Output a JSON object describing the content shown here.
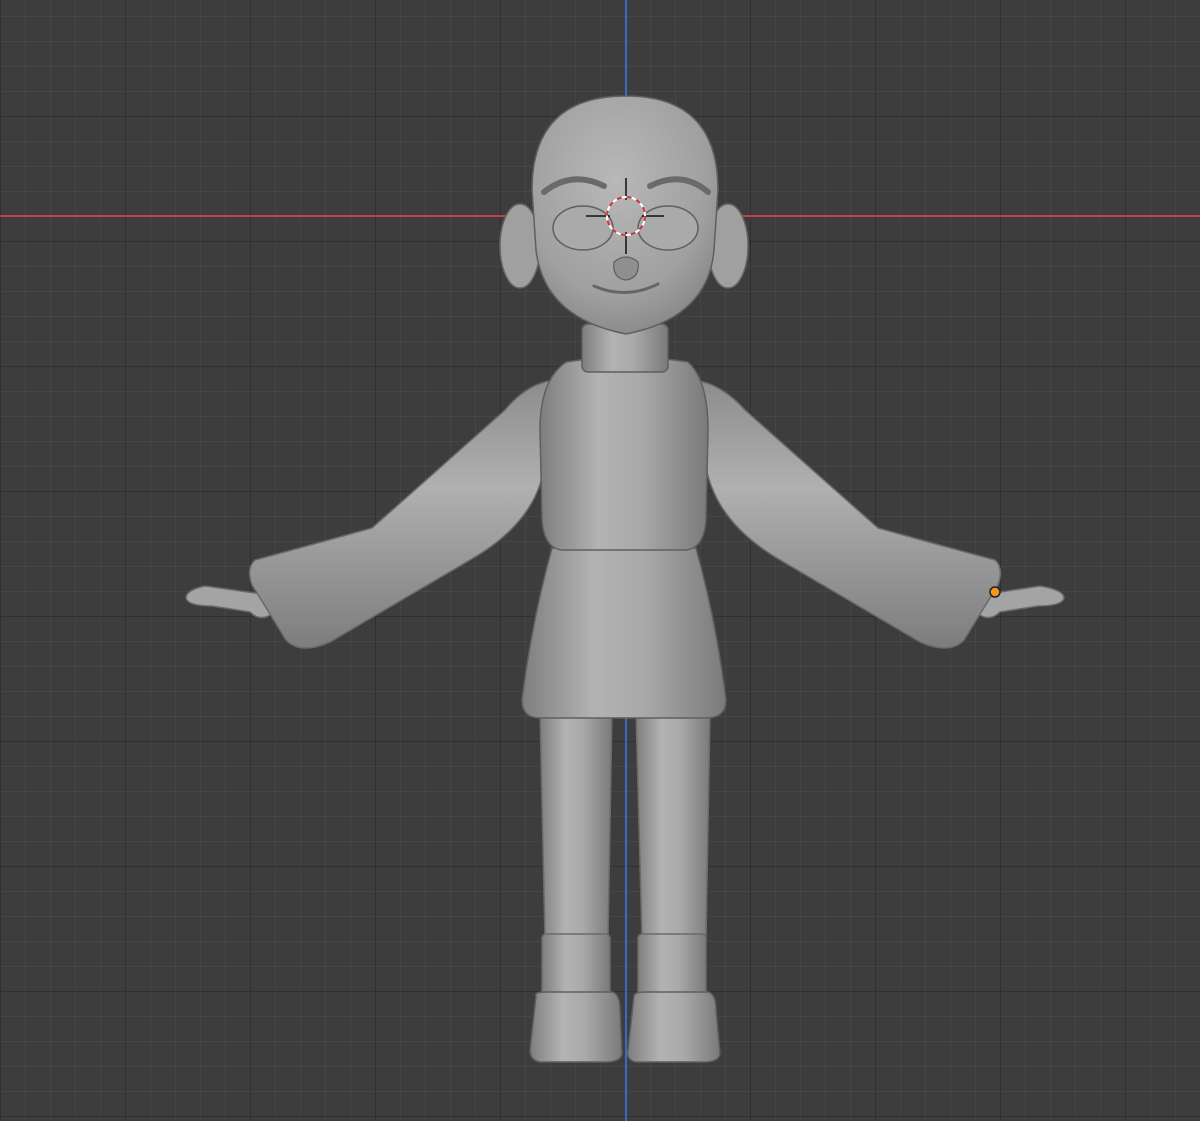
{
  "viewport": {
    "mode": "front-orthographic",
    "grid": true,
    "colors": {
      "background": "#3d3d3d",
      "x_axis": "#c2404f",
      "z_axis": "#3a6bc4",
      "mesh": "#a6a6a6",
      "origin_dot": "#f7931e"
    }
  },
  "scene": {
    "object": "character-mesh",
    "cursor_icon": "3d-cursor-icon",
    "origin_icon": "object-origin-icon",
    "selected": true
  }
}
